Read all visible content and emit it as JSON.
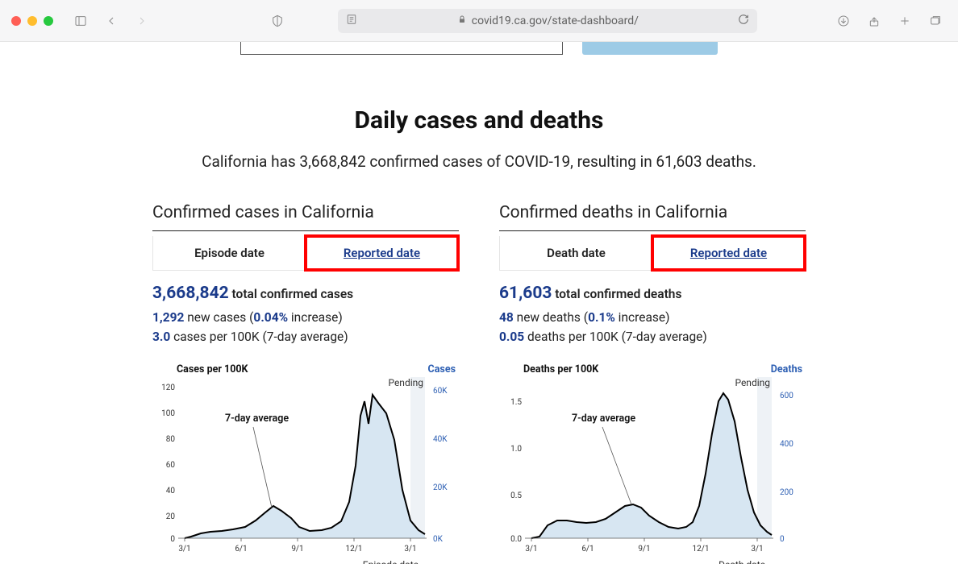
{
  "browser": {
    "url_display": "covid19.ca.gov/state-dashboard/"
  },
  "page": {
    "heading": "Daily cases and deaths",
    "subheading": "California has 3,668,842 confirmed cases of COVID-19, resulting in 61,603 deaths."
  },
  "cases": {
    "title": "Confirmed cases in California",
    "tab1": "Episode date",
    "tab2": "Reported date",
    "total_num": "3,668,842",
    "total_label": " total confirmed cases",
    "new_num": "1,292",
    "new_label": " new cases (",
    "new_pct": "0.04%",
    "new_suffix": " increase)",
    "per100k_num": "3.0",
    "per100k_label": " cases per 100K (7-day average)",
    "chart_left": "Cases per 100K",
    "chart_right": "Cases",
    "pending": "Pending",
    "avg": "7-day average",
    "xaxis": "Episode date"
  },
  "deaths": {
    "title": "Confirmed deaths in California",
    "tab1": "Death date",
    "tab2": "Reported date",
    "total_num": "61,603",
    "total_label": " total confirmed deaths",
    "new_num": "48",
    "new_label": " new deaths (",
    "new_pct": "0.1%",
    "new_suffix": " increase)",
    "per100k_num": "0.05",
    "per100k_label": " deaths per 100K (7-day average)",
    "chart_left": "Deaths per 100K",
    "chart_right": "Deaths",
    "pending": "Pending",
    "avg": "7-day average",
    "xaxis": "Death date"
  },
  "chart_data": [
    {
      "type": "line",
      "title": "Cases per 100K",
      "ylabel_left": "Cases per 100K",
      "ylabel_right": "Cases",
      "ylim_left": [
        0,
        120
      ],
      "ylim_right": [
        "0K",
        "60K"
      ],
      "y_ticks_left": [
        0,
        20,
        40,
        60,
        80,
        100,
        120
      ],
      "y_ticks_right": [
        "0K",
        "20K",
        "40K",
        "60K"
      ],
      "x_ticks": [
        "3/1",
        "6/1",
        "9/1",
        "12/1",
        "3/1"
      ],
      "xlabel": "Episode date",
      "annotation": "7-day average",
      "pending_region": true,
      "series": [
        {
          "name": "Cases per 100K (7-day avg)",
          "points": [
            {
              "x": "3/1",
              "y": 1
            },
            {
              "x": "3/15",
              "y": 3
            },
            {
              "x": "4/1",
              "y": 6
            },
            {
              "x": "4/15",
              "y": 6
            },
            {
              "x": "5/1",
              "y": 7
            },
            {
              "x": "5/15",
              "y": 8
            },
            {
              "x": "6/1",
              "y": 9
            },
            {
              "x": "6/15",
              "y": 12
            },
            {
              "x": "7/1",
              "y": 20
            },
            {
              "x": "7/15",
              "y": 25
            },
            {
              "x": "8/1",
              "y": 22
            },
            {
              "x": "8/15",
              "y": 17
            },
            {
              "x": "9/1",
              "y": 11
            },
            {
              "x": "9/15",
              "y": 8
            },
            {
              "x": "10/1",
              "y": 8
            },
            {
              "x": "10/15",
              "y": 10
            },
            {
              "x": "11/1",
              "y": 15
            },
            {
              "x": "11/15",
              "y": 32
            },
            {
              "x": "12/1",
              "y": 60
            },
            {
              "x": "12/10",
              "y": 100
            },
            {
              "x": "12/15",
              "y": 92
            },
            {
              "x": "12/20",
              "y": 110
            },
            {
              "x": "1/1",
              "y": 105
            },
            {
              "x": "1/15",
              "y": 85
            },
            {
              "x": "2/1",
              "y": 40
            },
            {
              "x": "2/15",
              "y": 18
            },
            {
              "x": "3/1",
              "y": 8
            },
            {
              "x": "3/15",
              "y": 5
            },
            {
              "x": "4/1",
              "y": 3
            },
            {
              "x": "4/15",
              "y": 2
            }
          ]
        }
      ]
    },
    {
      "type": "line",
      "title": "Deaths per 100K",
      "ylabel_left": "Deaths per 100K",
      "ylabel_right": "Deaths",
      "ylim_left": [
        0.0,
        1.7
      ],
      "ylim_right": [
        0,
        600
      ],
      "y_ticks_left": [
        0.0,
        0.5,
        1.0,
        1.5
      ],
      "y_ticks_right": [
        0,
        200,
        400,
        600
      ],
      "x_ticks": [
        "3/1",
        "6/1",
        "9/1",
        "12/1",
        "3/1"
      ],
      "xlabel": "Death date",
      "annotation": "7-day average",
      "pending_region": true,
      "series": [
        {
          "name": "Deaths per 100K (7-day avg)",
          "points": [
            {
              "x": "3/1",
              "y": 0.0
            },
            {
              "x": "3/15",
              "y": 0.02
            },
            {
              "x": "4/1",
              "y": 0.15
            },
            {
              "x": "4/15",
              "y": 0.2
            },
            {
              "x": "5/1",
              "y": 0.2
            },
            {
              "x": "5/15",
              "y": 0.18
            },
            {
              "x": "6/1",
              "y": 0.17
            },
            {
              "x": "6/15",
              "y": 0.18
            },
            {
              "x": "7/1",
              "y": 0.22
            },
            {
              "x": "7/15",
              "y": 0.3
            },
            {
              "x": "8/1",
              "y": 0.36
            },
            {
              "x": "8/15",
              "y": 0.33
            },
            {
              "x": "9/1",
              "y": 0.25
            },
            {
              "x": "9/15",
              "y": 0.2
            },
            {
              "x": "10/1",
              "y": 0.15
            },
            {
              "x": "10/15",
              "y": 0.12
            },
            {
              "x": "11/1",
              "y": 0.12
            },
            {
              "x": "11/15",
              "y": 0.18
            },
            {
              "x": "12/1",
              "y": 0.4
            },
            {
              "x": "12/15",
              "y": 0.9
            },
            {
              "x": "1/1",
              "y": 1.4
            },
            {
              "x": "1/10",
              "y": 1.65
            },
            {
              "x": "1/20",
              "y": 1.55
            },
            {
              "x": "2/1",
              "y": 1.2
            },
            {
              "x": "2/15",
              "y": 0.7
            },
            {
              "x": "3/1",
              "y": 0.35
            },
            {
              "x": "3/15",
              "y": 0.2
            },
            {
              "x": "4/1",
              "y": 0.1
            },
            {
              "x": "4/15",
              "y": 0.06
            }
          ]
        }
      ]
    }
  ]
}
